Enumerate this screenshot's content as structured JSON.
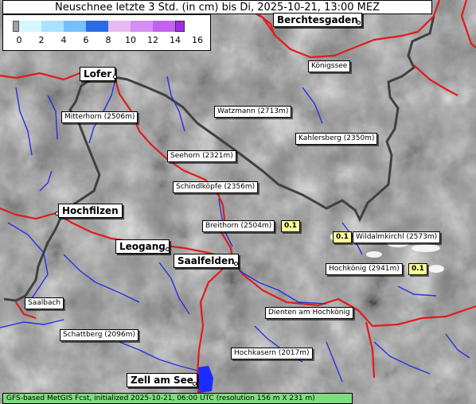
{
  "title": "Neuschnee letzte 3 Std. (in cm) bis Di, 2025-10-21, 13:00 MEZ",
  "legend": {
    "ticks": [
      "0",
      "2",
      "4",
      "6",
      "8",
      "10",
      "12",
      "14",
      "16"
    ],
    "colors": [
      "#d6f6ff",
      "#a9e2ff",
      "#75c0fa",
      "#4d9cf0",
      "#2a6be6",
      "#e7b9f3",
      "#d48ff0",
      "#c163ee",
      "#a22bea"
    ]
  },
  "towns": [
    {
      "name": "Berchtesgaden"
    },
    {
      "name": "Lofer"
    },
    {
      "name": "Hochfilzen"
    },
    {
      "name": "Leogang"
    },
    {
      "name": "Saalfelden"
    },
    {
      "name": "Zell am See"
    }
  ],
  "peaks": [
    {
      "name": "Königssee"
    },
    {
      "name": "Watzmann (2713m)"
    },
    {
      "name": "Mitterhorn (2506m)"
    },
    {
      "name": "Kahlersberg (2350m)"
    },
    {
      "name": "Seehorn (2321m)"
    },
    {
      "name": "Schindlköpfe (2356m)"
    },
    {
      "name": "Breithorn (2504m)"
    },
    {
      "name": "Wildalmkirchl (2573m)"
    },
    {
      "name": "Hochkönig (2941m)"
    },
    {
      "name": "Saalbach"
    },
    {
      "name": "Dienten am Hochkönig"
    },
    {
      "name": "Schattberg (2096m)"
    },
    {
      "name": "Hochkasern (2017m)"
    }
  ],
  "snow_values": [
    {
      "place": "Breithorn (2504m)",
      "value": "0.1"
    },
    {
      "place": "Wildalmkirchl (2573m)",
      "value": "0.1"
    },
    {
      "place": "Hochkönig (2941m)",
      "value": "0.1"
    }
  ],
  "footer": "GFS-based MetGIS Fcst, initialized 2025-10-21, 06:00 UTC  (resolution 156 m X 231 m)"
}
